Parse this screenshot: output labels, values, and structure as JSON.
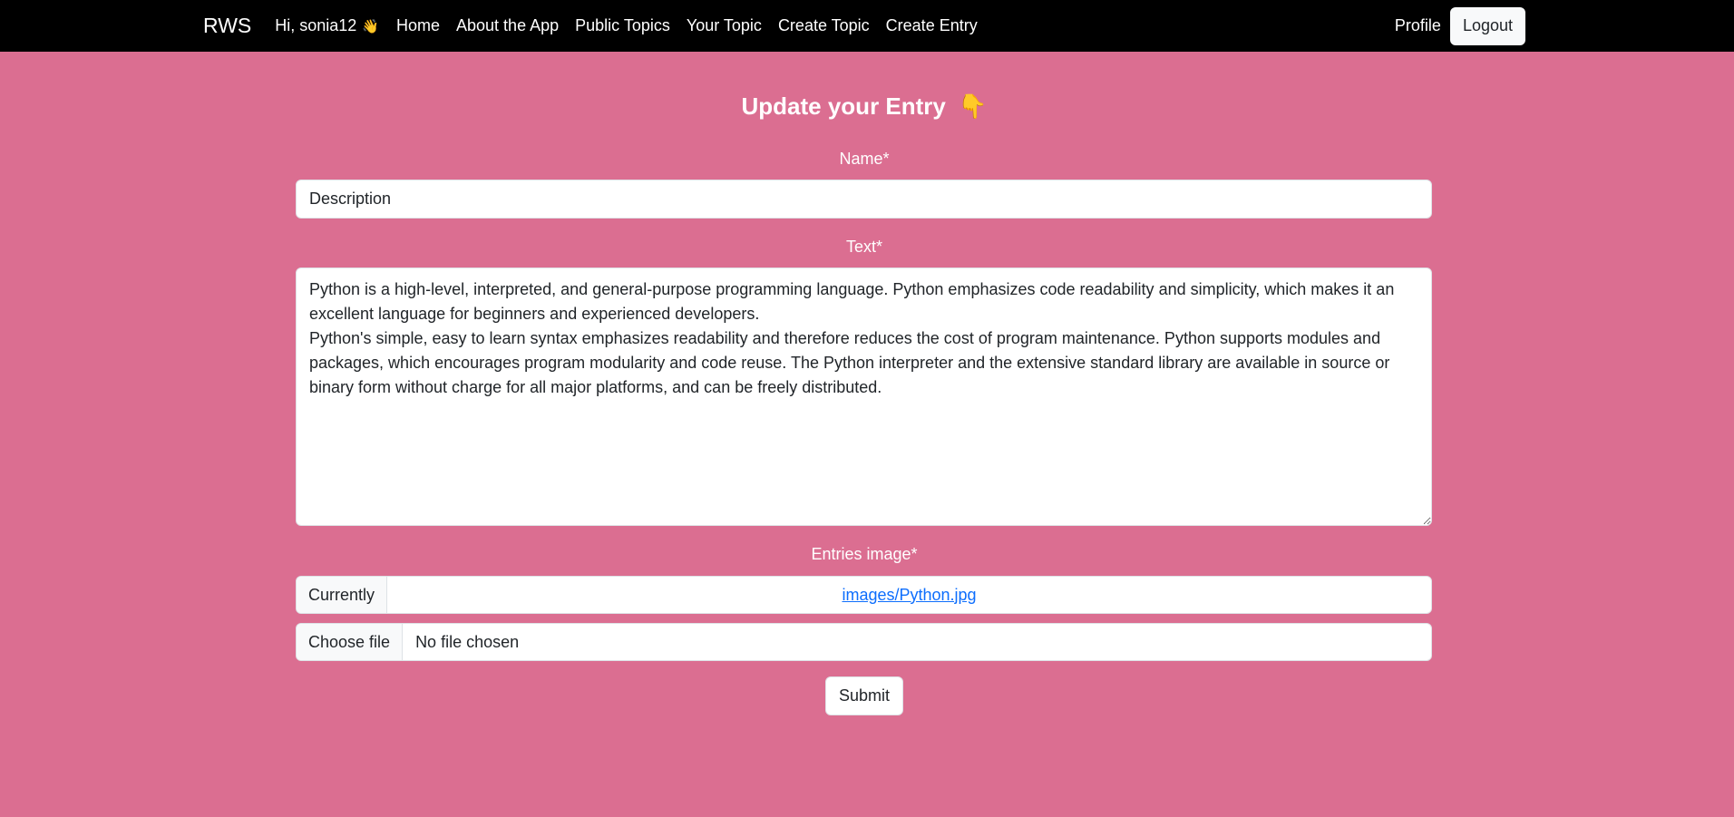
{
  "navbar": {
    "brand": "RWS",
    "greeting": "Hi, sonia12",
    "greeting_emoji": "👋",
    "links": [
      "Home",
      "About the App",
      "Public Topics",
      "Your Topic",
      "Create Topic",
      "Create Entry"
    ],
    "profile": "Profile",
    "logout": "Logout"
  },
  "page": {
    "title": "Update your Entry",
    "title_emoji": "👇"
  },
  "form": {
    "name_label": "Name*",
    "name_value": "Description",
    "text_label": "Text*",
    "text_value": "Python is a high-level, interpreted, and general-purpose programming language. Python emphasizes code readability and simplicity, which makes it an excellent language for beginners and experienced developers.\nPython's simple, easy to learn syntax emphasizes readability and therefore reduces the cost of program maintenance. Python supports modules and packages, which encourages program modularity and code reuse. The Python interpreter and the extensive standard library are available in source or binary form without charge for all major platforms, and can be freely distributed.",
    "image_label": "Entries image*",
    "currently_label": "Currently",
    "current_file": "images/Python.jpg",
    "choose_file": "Choose file",
    "no_file": "No file chosen",
    "submit": "Submit"
  },
  "colors": {
    "background": "#db6e91",
    "navbar": "#000000",
    "link": "#0d6efd"
  }
}
